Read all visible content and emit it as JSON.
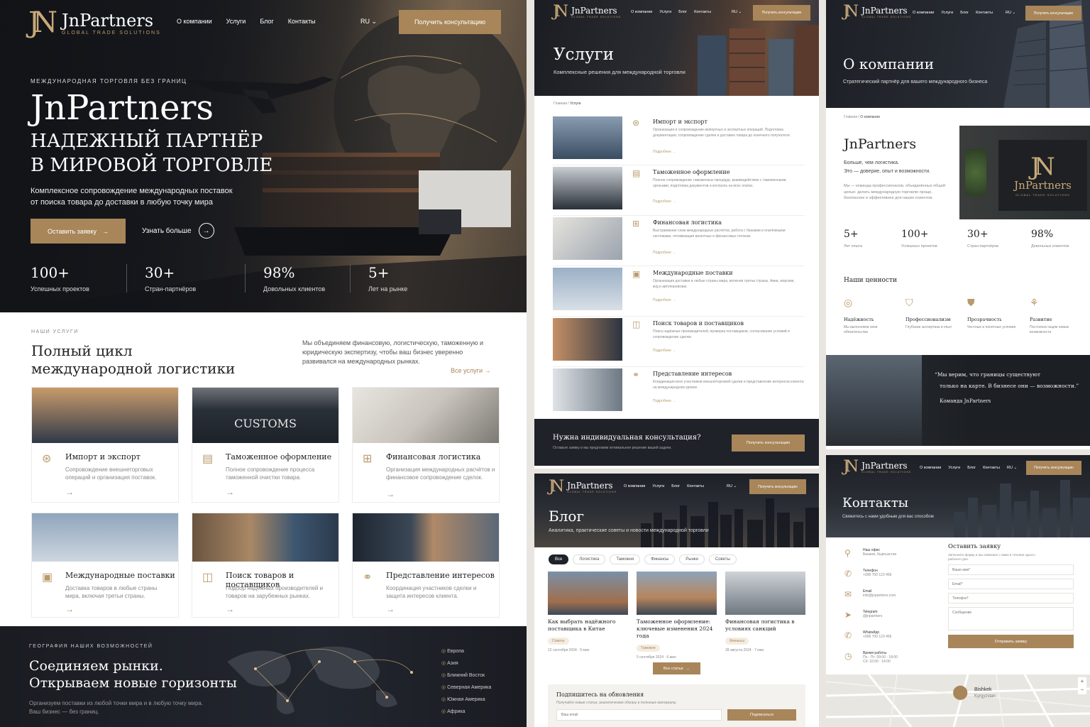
{
  "brand": {
    "name": "JnPartners",
    "tagline": "GLOBAL TRADE SOLUTIONS",
    "mono": "N"
  },
  "nav": {
    "items": [
      "О компании",
      "Услуги",
      "Блог",
      "Контакты"
    ],
    "lang": "RU",
    "cta": "Получить консультацию"
  },
  "hero": {
    "eyebrow": "МЕЖДУНАРОДНАЯ ТОРГОВЛЯ БЕЗ ГРАНИЦ",
    "title": "JnPartners",
    "subtitle1": "НАДЕЖНЫЙ ПАРТНЁР",
    "subtitle2": "В МИРОВОЙ ТОРГОВЛЕ",
    "desc1": "Комплексное сопровождение международных поставок",
    "desc2": "от поиска товара до доставки в любую точку мира",
    "btn_primary": "Оставить заявку",
    "btn_secondary": "Узнать больше",
    "stats": [
      {
        "v": "100+",
        "l": "Успешных проектов"
      },
      {
        "v": "30+",
        "l": "Стран-партнёров"
      },
      {
        "v": "98%",
        "l": "Довольных клиентов"
      },
      {
        "v": "5+",
        "l": "Лет на рынке"
      }
    ]
  },
  "services": {
    "eyebrow": "НАШИ УСЛУГИ",
    "title1": "Полный цикл",
    "title2": "международной логистики",
    "desc": "Мы объединяем финансовую, логистическую, таможенную и юридическую экспертизу, чтобы ваш бизнес уверенно развивался на международных рынках.",
    "all": "Все услуги",
    "cards": [
      {
        "title": "Импорт и экспорт",
        "text": "Сопровождение внешнеторговых операций и организация поставок."
      },
      {
        "title": "Таможенное оформление",
        "text": "Полное сопровождение процесса таможенной очистки товара.",
        "photo_text": "CUSTOMS"
      },
      {
        "title": "Финансовая логистика",
        "text": "Организация международных расчётов и финансовое сопровождение сделок."
      },
      {
        "title": "Международные поставки",
        "text": "Доставка товаров в любые страны мира, включая третьи страны."
      },
      {
        "title": "Поиск товаров и поставщиков",
        "text": "Подбор надёжных производителей и товаров на зарубежных рынках."
      },
      {
        "title": "Представление интересов",
        "text": "Координация участников сделки и защита интересов клиента."
      }
    ]
  },
  "geo": {
    "eyebrow": "ГЕОГРАФИЯ НАШИХ ВОЗМОЖНОСТЕЙ",
    "title1": "Соединяем рынки.",
    "title2": "Открываем новые горизонты",
    "desc1": "Организуем поставки из любой точки мира и в любую точку мира.",
    "desc2": "Ваш бизнес — без границ.",
    "regions": [
      "Европа",
      "Азия",
      "Ближний Восток",
      "Северная Америка",
      "Южная Америка",
      "Африка"
    ]
  },
  "svc_page": {
    "title": "Услуги",
    "subtitle": "Комплексные решения для международной торговли",
    "crumb": [
      "Главная",
      "Услуги"
    ],
    "more": "Подробнее",
    "items": [
      {
        "title": "Импорт и экспорт",
        "text": "Организация и сопровождение импортных и экспортных операций. Подготовка документации, сопровождение сделки и доставка товара до конечного получателя."
      },
      {
        "title": "Таможенное оформление",
        "text": "Полное сопровождение таможенных процедур, взаимодействие с таможенными органами, подготовка документов и контроль на всех этапах."
      },
      {
        "title": "Финансовая логистика",
        "text": "Выстраивание схем международных расчётов, работа с банками и платёжными системами, оптимизация валютных и финансовых потоков."
      },
      {
        "title": "Международные поставки",
        "text": "Организация доставки в любые страны мира, включая третьи страны. Авиа, морские, ж/д и автоперевозки."
      },
      {
        "title": "Поиск товаров и поставщиков",
        "text": "Поиск надёжных производителей, проверка поставщиков, согласование условий и сопровождение сделки."
      },
      {
        "title": "Представление интересов",
        "text": "Координация всех участников внешнеторговой сделки и представление интересов клиента на международном уровне."
      }
    ],
    "consult_title": "Нужна индивидуальная консультация?",
    "consult_text": "Оставьте заявку и мы предложим оптимальное решение вашей задачи.",
    "consult_btn": "Получить консультацию"
  },
  "blog": {
    "title": "Блог",
    "subtitle": "Аналитика, практические советы и новости международной торговли",
    "filters": [
      "Все",
      "Логистика",
      "Таможня",
      "Финансы",
      "Рынки",
      "Советы"
    ],
    "posts": [
      {
        "title": "Как выбрать надёжного поставщика в Китае",
        "tag": "Советы",
        "date": "12 сентября 2024",
        "read": "5 мин"
      },
      {
        "title": "Таможенное оформление: ключевые изменения 2024 года",
        "tag": "Таможня",
        "date": "5 сентября 2024",
        "read": "6 мин"
      },
      {
        "title": "Финансовая логистика в условиях санкций",
        "tag": "Финансы",
        "date": "28 августа 2024",
        "read": "7 мин"
      }
    ],
    "all_btn": "Все статьи",
    "sub_title": "Подпишитесь на обновления",
    "sub_text": "Получайте новые статьи, аналитические обзоры и полезные материалы.",
    "sub_placeholder": "Ваш email",
    "sub_btn": "Подписаться"
  },
  "about": {
    "title": "О компании",
    "subtitle": "Стратегический партнёр для вашего международного бизнеса",
    "crumb": [
      "Главная",
      "О компании"
    ],
    "name": "JnPartners",
    "lead1": "Больше, чем логистика.",
    "lead2": "Это — доверие, опыт и возможности.",
    "text": "Мы — команда профессионалов, объединённых общей целью: делать международную торговлю проще, безопаснее и эффективнее для наших клиентов.",
    "stats": [
      {
        "v": "5+",
        "l": "Лет опыта"
      },
      {
        "v": "100+",
        "l": "Успешных проектов"
      },
      {
        "v": "30+",
        "l": "Стран-партнёров"
      },
      {
        "v": "98%",
        "l": "Довольных клиентов"
      }
    ],
    "values_title": "Наши ценности",
    "values": [
      {
        "t": "Надёжность",
        "d": "Мы выполняем свои обязательства"
      },
      {
        "t": "Профессионализм",
        "d": "Глубокая экспертиза и опыт"
      },
      {
        "t": "Прозрачность",
        "d": "Честные и понятные условия"
      },
      {
        "t": "Развитие",
        "d": "Постоянно ищем новые возможности"
      }
    ],
    "quote1": "“Мы верим, что границы существуют",
    "quote2": "только на карте. В бизнесе они — возможности.”",
    "quote_by": "Команда JnPartners"
  },
  "contacts": {
    "title": "Контакты",
    "subtitle": "Свяжитесь с нами удобным для вас способом",
    "items": [
      {
        "l": "Наш офис",
        "v": "Бишкек, Кыргызстан"
      },
      {
        "l": "Телефон",
        "v": "+996 700 123 456"
      },
      {
        "l": "Email",
        "v": "info@jnpartners.com"
      },
      {
        "l": "Telegram",
        "v": "@jnpartners"
      },
      {
        "l": "WhatsApp",
        "v": "+996 700 123 456"
      },
      {
        "l": "Время работы",
        "v": "Пн - Пт: 09:00 - 18:00",
        "v2": "Сб: 10:00 - 14:00"
      }
    ],
    "form_title": "Оставить заявку",
    "form_text": "Заполните форму и мы свяжемся с вами в течение одного рабочего дня.",
    "ph_name": "Ваше имя*",
    "ph_email": "Email*",
    "ph_phone": "Телефон*",
    "ph_msg": "Сообщение",
    "form_btn": "Отправить заявку",
    "map_city": "Bishkek",
    "map_country": "Kyrgyzstan"
  }
}
